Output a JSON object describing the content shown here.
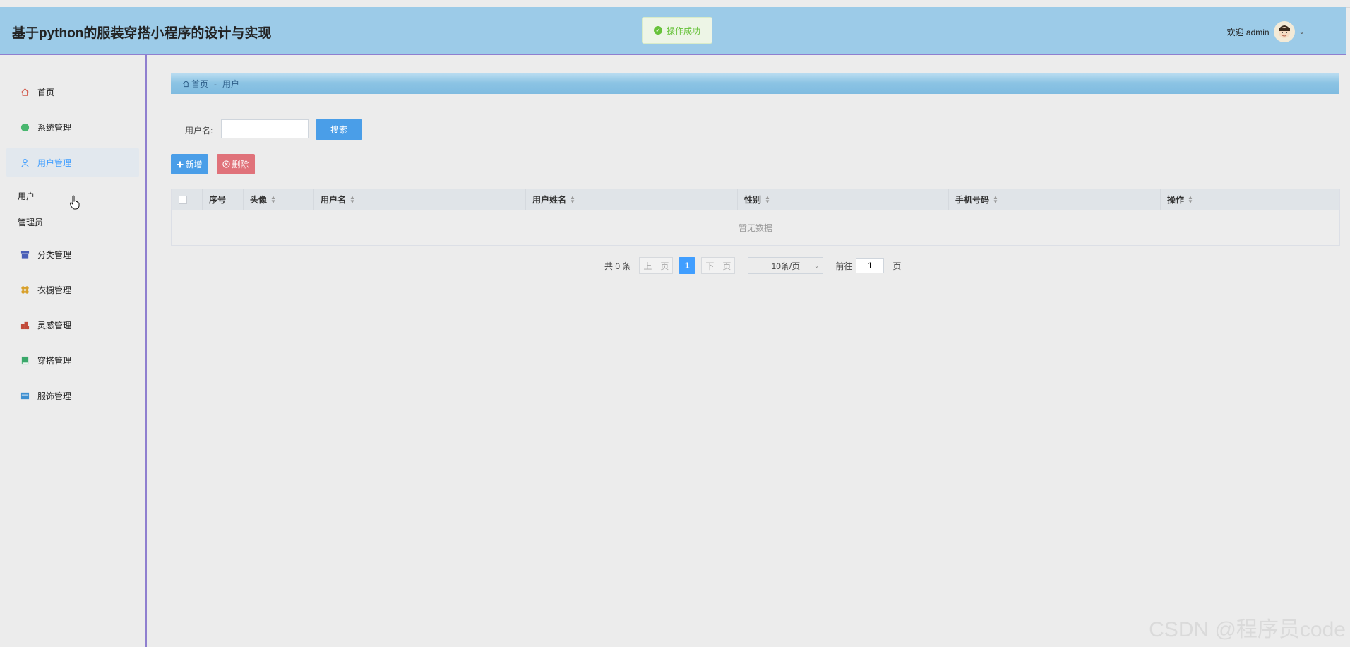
{
  "app": {
    "title": "基于python的服装穿搭小程序的设计与实现"
  },
  "toast": {
    "message": "操作成功"
  },
  "user": {
    "greeting": "欢迎 admin"
  },
  "sidebar": {
    "items": [
      {
        "label": "首页",
        "icon": "home-icon"
      },
      {
        "label": "系统管理",
        "icon": "circle-icon"
      },
      {
        "label": "用户管理",
        "icon": "user-icon",
        "active": true
      },
      {
        "label": "分类管理",
        "icon": "archive-icon"
      },
      {
        "label": "衣橱管理",
        "icon": "grid-icon"
      },
      {
        "label": "灵感管理",
        "icon": "building-icon"
      },
      {
        "label": "穿搭管理",
        "icon": "book-icon"
      },
      {
        "label": "服饰管理",
        "icon": "window-icon"
      }
    ],
    "sub_items": [
      "用户",
      "管理员"
    ]
  },
  "breadcrumb": {
    "home": "首页",
    "current": "用户"
  },
  "search": {
    "label": "用户名:",
    "value": "",
    "placeholder": "",
    "button": "搜索"
  },
  "actions": {
    "add": "新增",
    "delete": "删除"
  },
  "table": {
    "columns": [
      "序号",
      "头像",
      "用户名",
      "用户姓名",
      "性别",
      "手机号码",
      "操作"
    ],
    "empty_text": "暂无数据"
  },
  "pagination": {
    "total_text": "共 0 条",
    "prev": "上一页",
    "current_page": "1",
    "next": "下一页",
    "page_size": "10条/页",
    "goto_label": "前往",
    "goto_value": "1",
    "page_suffix": "页"
  },
  "watermark": "CSDN @程序员code"
}
